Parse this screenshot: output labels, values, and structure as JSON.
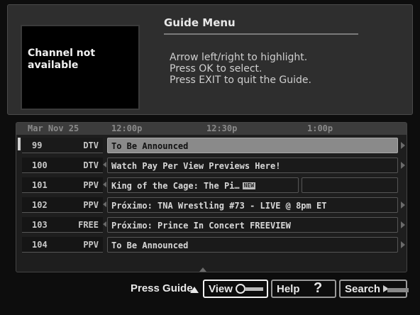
{
  "preview": {
    "message_line1": "Channel not",
    "message_line2": "available"
  },
  "menu": {
    "title": "Guide Menu",
    "instructions": [
      "Arrow left/right to highlight.",
      "Press OK to select.",
      "Press EXIT to quit the Guide."
    ]
  },
  "grid": {
    "date": "Mar Nov 25",
    "times": [
      "12:00p",
      "12:30p",
      "1:00p"
    ],
    "rows": [
      {
        "channel": "99",
        "network": "DTV",
        "program": "To Be Announced",
        "selected": true
      },
      {
        "channel": "100",
        "network": "DTV",
        "program": "Watch Pay Per View Previews Here!"
      },
      {
        "channel": "101",
        "network": "PPV",
        "program": "King of the Cage: The Pi…",
        "badge": "NEW"
      },
      {
        "channel": "102",
        "network": "PPV",
        "program": "Próximo: TNA Wrestling #73 - LIVE @ 8pm ET"
      },
      {
        "channel": "103",
        "network": "FREE",
        "program": "Próximo: Prince In Concert FREEVIEW"
      },
      {
        "channel": "104",
        "network": "PPV",
        "program": "To Be Announced"
      }
    ]
  },
  "footer": {
    "press_guide": "Press Guide",
    "view_label": "View",
    "help_label": "Help",
    "help_symbol": "?",
    "search_label": "Search"
  }
}
